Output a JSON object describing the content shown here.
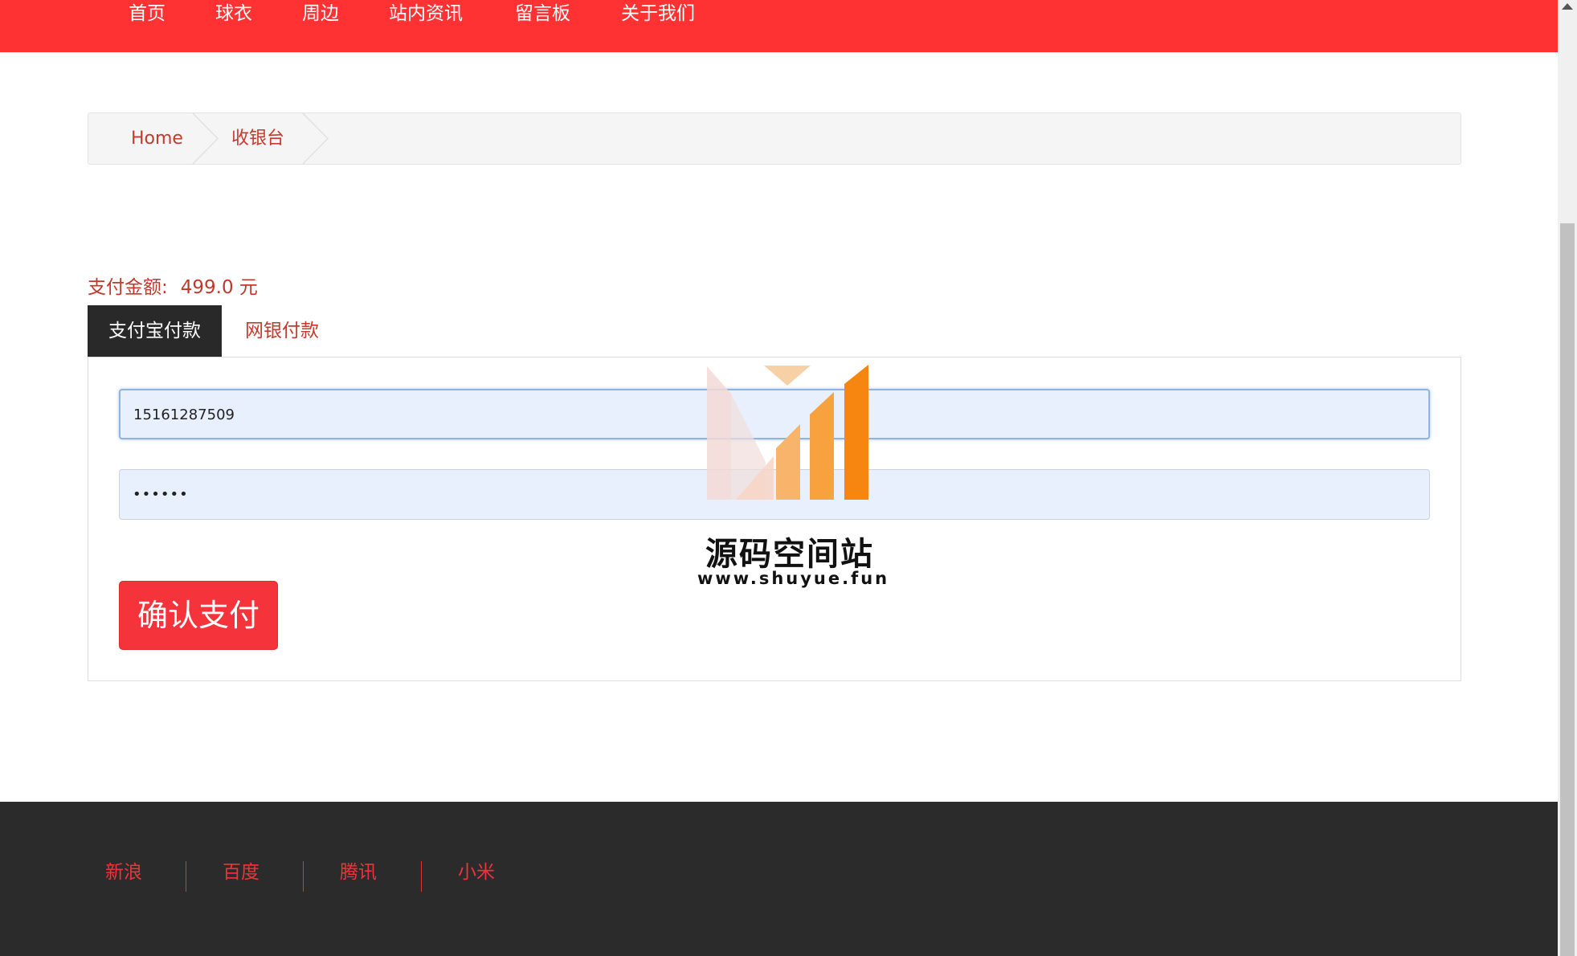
{
  "nav": {
    "items": [
      {
        "label": "首页"
      },
      {
        "label": "球衣"
      },
      {
        "label": "周边"
      },
      {
        "label": "站内资讯"
      },
      {
        "label": "留言板"
      },
      {
        "label": "关于我们"
      }
    ]
  },
  "breadcrumb": {
    "items": [
      {
        "label": "Home"
      },
      {
        "label": "收银台"
      }
    ]
  },
  "payment": {
    "amount_label": "支付金额:",
    "amount_value": "499.0 元",
    "tabs": [
      {
        "label": "支付宝付款",
        "active": true
      },
      {
        "label": "网银付款",
        "active": false
      }
    ],
    "account_value": "15161287509",
    "password_mask": "••••••",
    "confirm_label": "确认支付"
  },
  "watermark": {
    "title": "源码空间站",
    "url": "www.shuyue.fun"
  },
  "footer": {
    "links": [
      {
        "label": "新浪"
      },
      {
        "label": "百度"
      },
      {
        "label": "腾讯"
      },
      {
        "label": "小米"
      }
    ]
  },
  "colors": {
    "brand_red": "#fe3233",
    "link_red": "#c33a2f",
    "footer_bg": "#2b2b2b",
    "tab_active_bg": "#292929",
    "input_bg": "#e8f0fd"
  }
}
